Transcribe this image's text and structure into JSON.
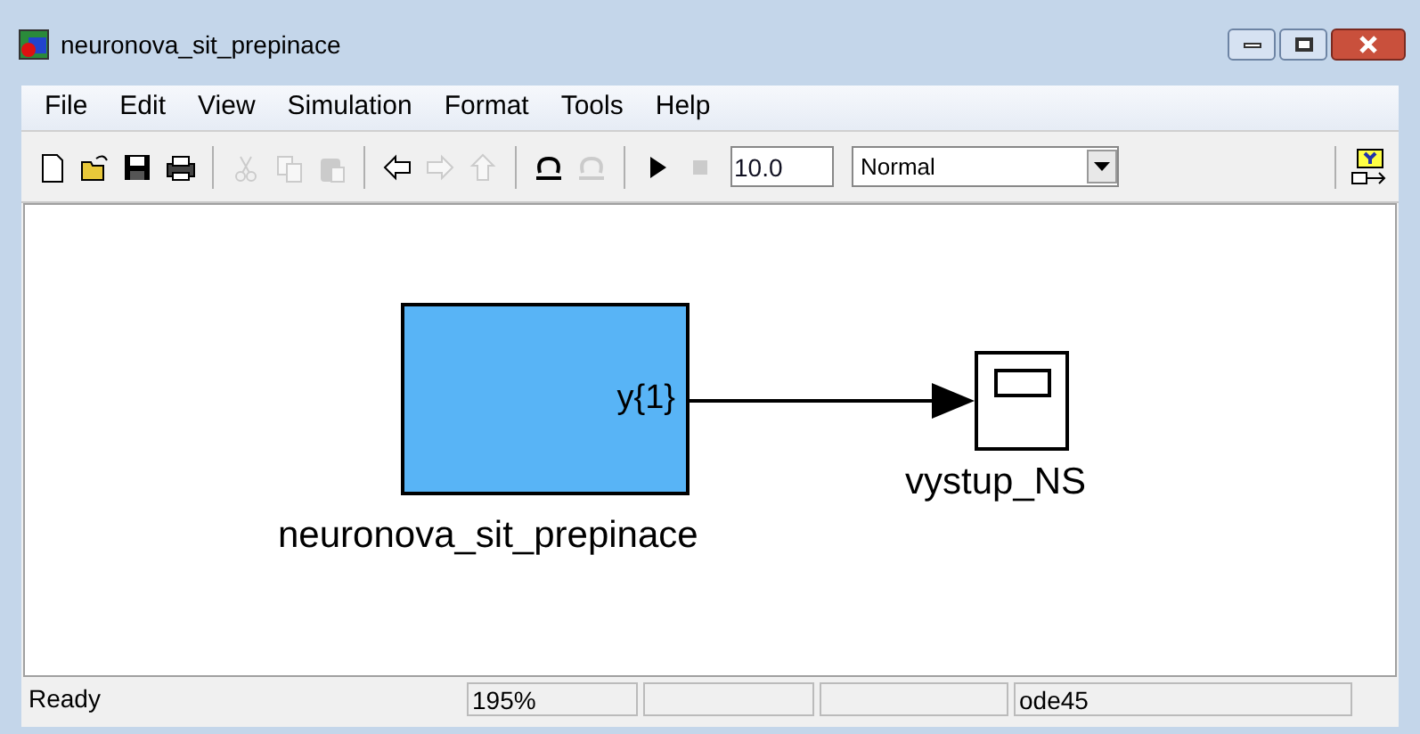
{
  "window": {
    "title": "neuronova_sit_prepinace"
  },
  "menu": [
    "File",
    "Edit",
    "View",
    "Simulation",
    "Format",
    "Tools",
    "Help"
  ],
  "toolbar": [
    {
      "kind": "new",
      "disabled": false
    },
    {
      "kind": "open",
      "disabled": false
    },
    {
      "kind": "save",
      "disabled": false
    },
    {
      "kind": "print",
      "disabled": false
    },
    {
      "kind": "sep"
    },
    {
      "kind": "cut",
      "disabled": true
    },
    {
      "kind": "copy",
      "disabled": true
    },
    {
      "kind": "paste",
      "disabled": true
    },
    {
      "kind": "sep"
    },
    {
      "kind": "back",
      "disabled": false
    },
    {
      "kind": "forward",
      "disabled": true
    },
    {
      "kind": "up",
      "disabled": true
    },
    {
      "kind": "sep"
    },
    {
      "kind": "undo",
      "disabled": false
    },
    {
      "kind": "redo",
      "disabled": true
    },
    {
      "kind": "sep"
    },
    {
      "kind": "play",
      "disabled": false
    },
    {
      "kind": "stop",
      "disabled": true
    }
  ],
  "stop_time": {
    "value": "10.0"
  },
  "mode": {
    "value": "Normal"
  },
  "diagram": {
    "blocks": [
      {
        "kind": "subsystem",
        "port": "y{1}",
        "label": "neuronova_sit_prepinace"
      },
      {
        "kind": "scope",
        "label": "vystup_NS"
      }
    ]
  },
  "status_bar": {
    "message": "Ready",
    "zoom": "195%",
    "solver": "ode45"
  }
}
